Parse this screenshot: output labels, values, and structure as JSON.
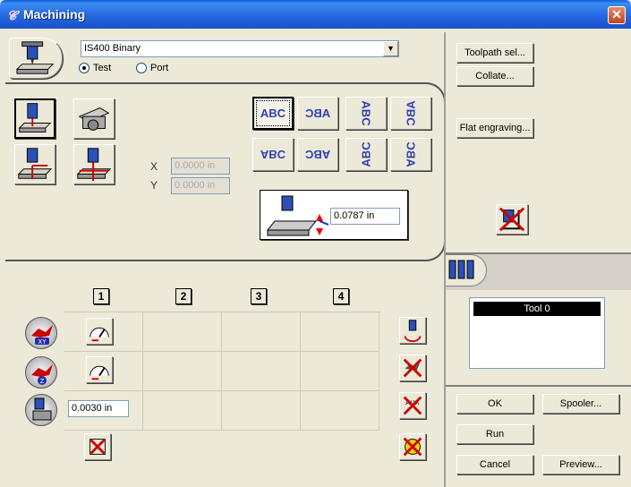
{
  "window": {
    "title": "Machining",
    "close_label": "✕"
  },
  "device": {
    "selected": "IS400 Binary",
    "radio_test": "Test",
    "radio_port": "Port"
  },
  "position": {
    "x_label": "X",
    "x_value": "0.0000 in",
    "y_label": "Y",
    "y_value": "0.0000 in"
  },
  "orientation": {
    "labels": [
      "ABC",
      "ABC",
      "ABC",
      "ABC",
      "ABC",
      "ABC",
      "ABC",
      "ABC"
    ]
  },
  "depth": {
    "value": "0.0787 in"
  },
  "passes": {
    "columns": [
      "1",
      "2",
      "3",
      "4"
    ],
    "tolerance_value": "0.0030 in"
  },
  "right_panel": {
    "toolpath_label": "Toolpath sel...",
    "collate_label": "Collate...",
    "flat_engraving_label": "Flat engraving...",
    "tool_list": [
      "Tool 0"
    ],
    "ok_label": "OK",
    "spooler_label": "Spooler...",
    "run_label": "Run",
    "cancel_label": "Cancel",
    "preview_label": "Preview..."
  },
  "colors": {
    "title_blue": "#2a6fe4",
    "abc_blue": "#2e3fb2",
    "face": "#ece9d8",
    "selected_tool_bg": "#000000"
  }
}
